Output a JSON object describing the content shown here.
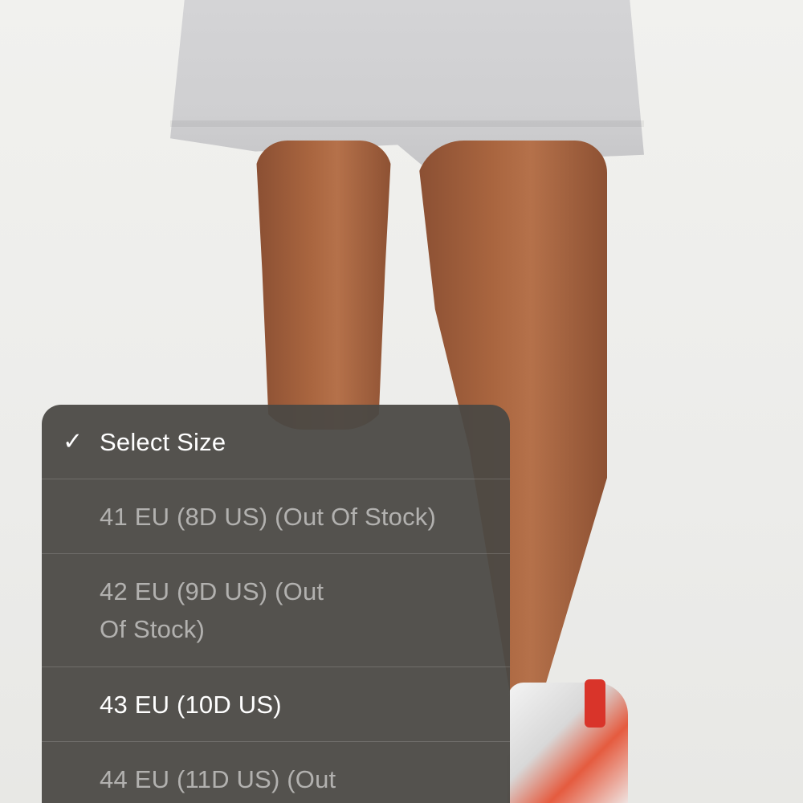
{
  "size_menu": {
    "items": [
      {
        "label": "Select Size",
        "selected": true,
        "available": true
      },
      {
        "label": "41 EU (8D US) (Out Of Stock)",
        "selected": false,
        "available": false
      },
      {
        "label": "42 EU (9D US) (Out Of Stock)",
        "selected": false,
        "available": false
      },
      {
        "label": "43 EU (10D US)",
        "selected": false,
        "available": true
      },
      {
        "label": "44 EU (11D US) (Out",
        "selected": false,
        "available": false
      }
    ],
    "check_icon": "checkmark-icon"
  },
  "photo": {
    "subject": "model-wearing-grey-shorts-and-sneakers",
    "colors": {
      "shorts": "#d4d4d6",
      "skin": "#a9653f",
      "background": "#efefec",
      "menu": "#4a4844",
      "sneaker_accent": "#e55b3f"
    }
  }
}
